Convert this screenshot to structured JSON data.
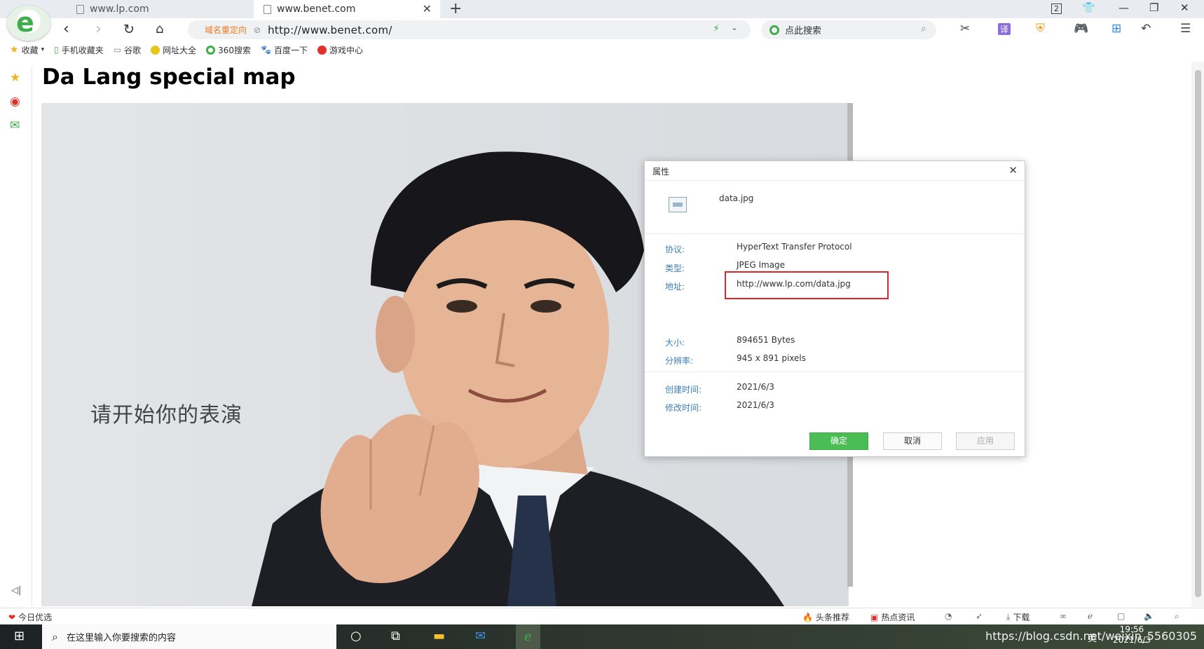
{
  "browser": {
    "tabs": [
      {
        "title": "www.lp.com"
      },
      {
        "title": "www.benet.com"
      }
    ],
    "new_tab": "+",
    "window_page_count": "2",
    "address": {
      "redirect_label": "域名重定向",
      "url": "http://www.benet.com/"
    },
    "search": {
      "placeholder": "点此搜索"
    },
    "toolbar_tools": {
      "translate": "译"
    }
  },
  "bookmarks": [
    {
      "label": "收藏",
      "icon": "star-icon"
    },
    {
      "label": "手机收藏夹",
      "icon": "phone-icon"
    },
    {
      "label": "谷歌",
      "icon": "doc-icon"
    },
    {
      "label": "网址大全",
      "icon": "globe-icon"
    },
    {
      "label": "360搜索",
      "icon": "so-icon"
    },
    {
      "label": "百度一下",
      "icon": "paw-icon"
    },
    {
      "label": "游戏中心",
      "icon": "game-icon"
    }
  ],
  "page": {
    "heading": "Da Lang special map",
    "poster_text": "请开始你的表演"
  },
  "dialog": {
    "title": "属性",
    "file_name": "data.jpg",
    "rows": [
      {
        "label": "协议:",
        "value": "HyperText Transfer Protocol"
      },
      {
        "label": "类型:",
        "value": "JPEG Image"
      },
      {
        "label": "地址:",
        "value": "http://www.lp.com/data.jpg"
      },
      {
        "label": "大小:",
        "value": "894651 Bytes"
      },
      {
        "label": "分辨率:",
        "value": "945 x 891 pixels"
      },
      {
        "label": "创建时间:",
        "value": "2021/6/3"
      },
      {
        "label": "修改时间:",
        "value": "2021/6/3"
      }
    ],
    "buttons": {
      "ok": "确定",
      "cancel": "取消",
      "apply": "应用"
    }
  },
  "statusbar": {
    "today": "今日优选",
    "headline": "头条推荐",
    "hot_news": "热点资讯",
    "download": "下载"
  },
  "taskbar": {
    "search_placeholder": "在这里输入你要搜索的内容",
    "time": "19:56",
    "date": "2021/6/3",
    "ime": "英",
    "watermark": "https://blog.csdn.net/weixin_5560305"
  }
}
